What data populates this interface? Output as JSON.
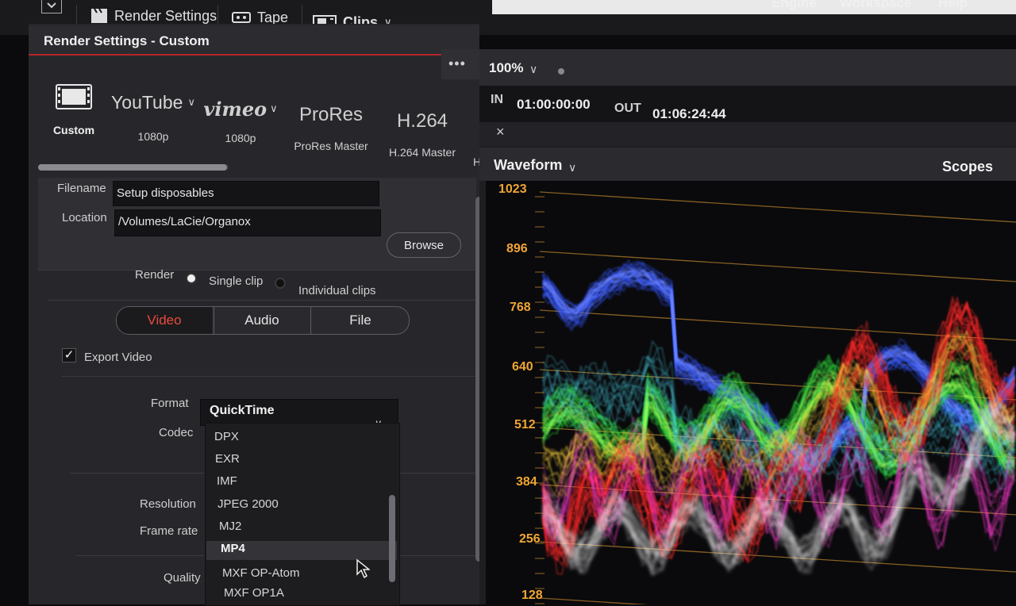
{
  "toolbar": {
    "render_settings": "Render Settings",
    "tape": "Tape",
    "clips": "Clips",
    "menu_partial": [
      "Engine",
      "Workspace",
      "Help"
    ]
  },
  "panel": {
    "title": "Render Settings - Custom",
    "more_dots": "•••"
  },
  "presets": [
    {
      "logo": "",
      "label": "Custom",
      "icon": "film-strip-icon"
    },
    {
      "logo": "YouTube",
      "label": "1080p",
      "icon": "youtube-logo"
    },
    {
      "logo": "vimeo",
      "label": "1080p",
      "icon": "vimeo-logo"
    },
    {
      "logo": "ProRes",
      "label": "ProRes Master"
    },
    {
      "logo": "H.264",
      "label": "H.264 Master"
    },
    {
      "logo": "",
      "label": "H"
    }
  ],
  "file": {
    "filename_label": "Filename",
    "filename_value": "Setup disposables",
    "location_label": "Location",
    "location_value": "/Volumes/LaCie/Organox",
    "browse": "Browse"
  },
  "render": {
    "label": "Render",
    "single_clip": "Single clip",
    "individual_clips": "Individual clips",
    "selected": "single_clip"
  },
  "tabs": {
    "video": "Video",
    "audio": "Audio",
    "file": "File",
    "active": "video"
  },
  "export_video": {
    "label": "Export Video",
    "checked": true
  },
  "settings": {
    "format_label": "Format",
    "format_value": "QuickTime",
    "codec_label": "Codec",
    "resolution_label": "Resolution",
    "frame_rate_label": "Frame rate",
    "quality_label": "Quality"
  },
  "dropdown": {
    "items": [
      "DPX",
      "EXR",
      "IMF",
      "JPEG 2000",
      "MJ2",
      "MP4",
      "MXF OP-Atom",
      "MXF OP1A"
    ],
    "highlighted": "MP4"
  },
  "viewer": {
    "zoom": "100%",
    "in_label": "IN",
    "in_value": "01:00:00:00",
    "out_label": "OUT",
    "out_value": "01:06:24:44",
    "close": "×"
  },
  "scope": {
    "title": "Waveform",
    "scopes_label": "Scopes",
    "y_ticks": [
      "1023",
      "896",
      "768",
      "640",
      "512",
      "384",
      "256",
      "128"
    ],
    "tick_color": "#f0a634"
  },
  "colors": {
    "accent_red": "#e84a3c",
    "panel_bg": "#27272b",
    "scope_bg": "#0a0a0c"
  }
}
